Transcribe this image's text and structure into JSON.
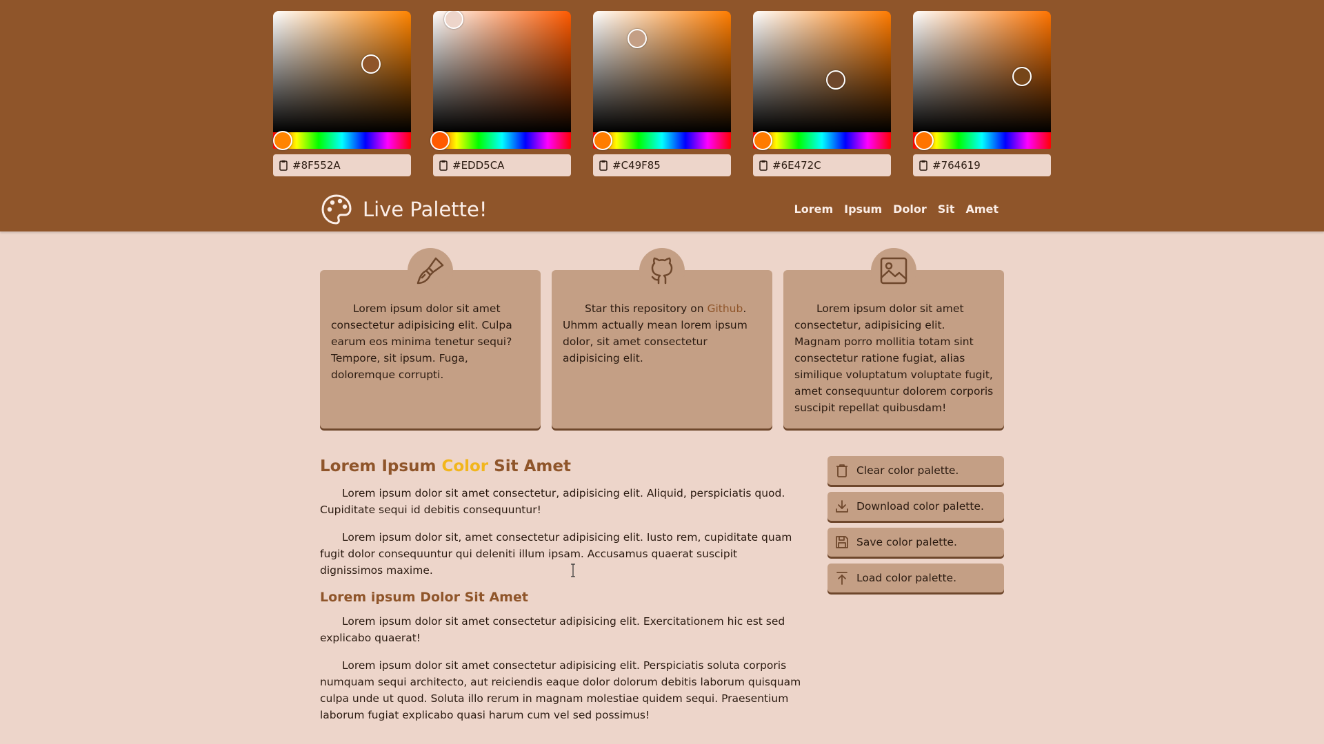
{
  "pickers": [
    {
      "hex": "#8F552A",
      "base": "#ff8400",
      "saturation": 0.71,
      "value": 0.56,
      "hue_fraction": 0.07
    },
    {
      "hex": "#EDD5CA",
      "base": "#ff5a00",
      "saturation": 0.15,
      "value": 0.93,
      "hue_fraction": 0.05
    },
    {
      "hex": "#C49F85",
      "base": "#ff7d00",
      "saturation": 0.32,
      "value": 0.77,
      "hue_fraction": 0.07
    },
    {
      "hex": "#6E472C",
      "base": "#ff7b00",
      "saturation": 0.6,
      "value": 0.43,
      "hue_fraction": 0.07
    },
    {
      "hex": "#764619",
      "base": "#ff7400",
      "saturation": 0.79,
      "value": 0.46,
      "hue_fraction": 0.08
    }
  ],
  "brand": {
    "title": "Live Palette!",
    "icon": "palette-icon"
  },
  "menu": [
    "Lorem",
    "Ipsum",
    "Dolor",
    "Sit",
    "Amet"
  ],
  "cards": [
    {
      "icon": "brush-icon",
      "text": "Lorem ipsum dolor sit amet consectetur adipisicing elit. Culpa earum eos minima tenetur sequi? Tempore, sit ipsum. Fuga, doloremque corrupti."
    },
    {
      "icon": "github-icon",
      "text_before": "Star this repository on ",
      "link": "Github",
      "text_after": ". Uhmm actually mean lorem ipsum dolor, sit amet consectetur adipisicing elit."
    },
    {
      "icon": "image-icon",
      "text": "Lorem ipsum dolor sit amet consectetur, adipisicing elit. Magnam porro mollitia totam sint consectetur ratione fugiat, alias similique voluptatum voluptate fugit, amet consequuntur dolorem corporis suscipit repellat quibusdam!"
    }
  ],
  "content": {
    "h1_before": "Lorem Ipsum ",
    "h1_accent": "Color",
    "h1_after": " Sit Amet",
    "p1": "Lorem ipsum dolor sit amet consectetur, adipisicing elit. Aliquid, perspiciatis quod. Cupiditate sequi id debitis consequuntur!",
    "p2": "Lorem ipsum dolor sit, amet consectetur adipisicing elit. Iusto rem, cupiditate quam fugit dolor consequuntur qui deleniti illum ipsam. Accusamus quaerat suscipit dignissimos maxime.",
    "h2": "Lorem ipsum Dolor Sit Amet",
    "p3": "Lorem ipsum dolor sit amet consectetur adipisicing elit. Exercitationem hic est sed explicabo quaerat!",
    "p4": "Lorem ipsum dolor sit amet consectetur adipisicing elit. Perspiciatis soluta corporis numquam sequi architecto, aut reiciendis eaque dolor dolorum debitis laborum quisquam culpa unde ut quod. Soluta illo rerum in magnam molestiae quidem sequi. Praesentium laborum fugiat explicabo quasi harum cum vel sed possimus!"
  },
  "actions": [
    {
      "icon": "trash-icon",
      "label": "Clear color palette."
    },
    {
      "icon": "download-icon",
      "label": "Download color palette."
    },
    {
      "icon": "save-icon",
      "label": "Save color palette."
    },
    {
      "icon": "upload-icon",
      "label": "Load color palette."
    }
  ],
  "colors": {
    "primary": "#8F552A",
    "light": "#EDD5CA",
    "mid": "#C49F85",
    "dark": "#6E472C",
    "accent": "#F2B61C"
  }
}
